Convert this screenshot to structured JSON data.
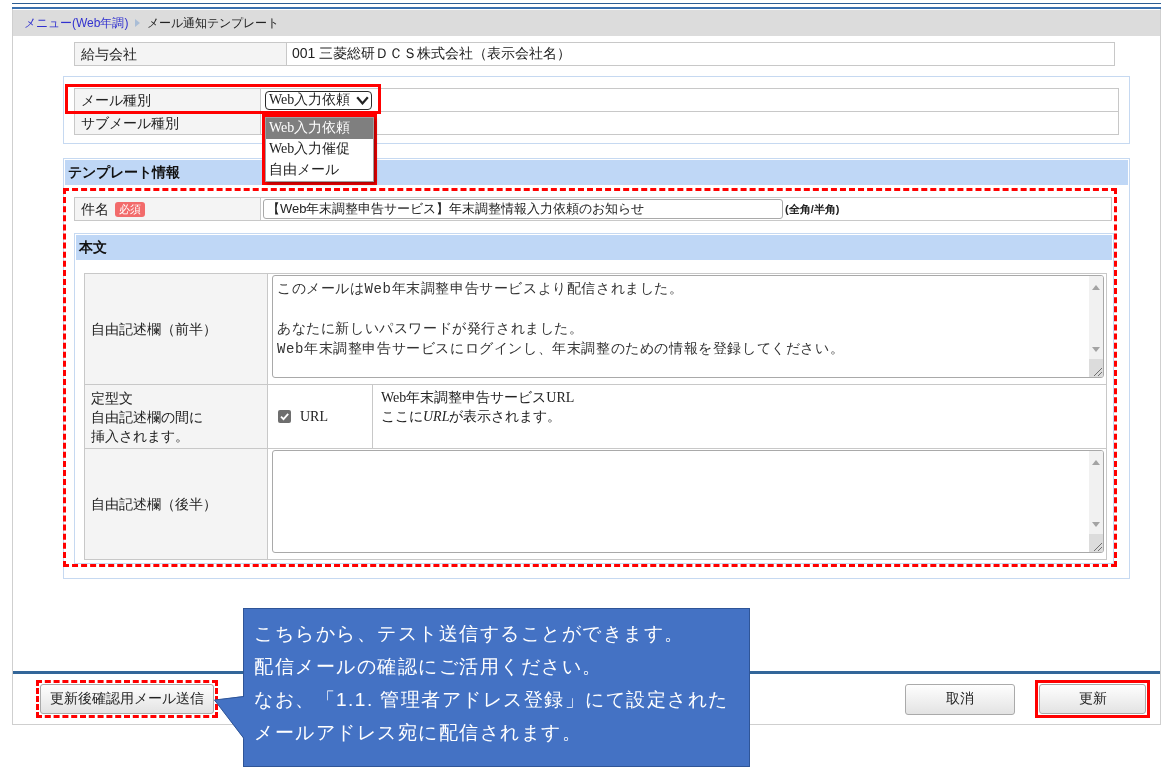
{
  "breadcrumb": [
    {
      "label": "メニュー(Web年調)",
      "kind": "link"
    },
    {
      "label": "メール通知テンプレート",
      "kind": "current"
    }
  ],
  "company": {
    "label": "給与会社",
    "value": "001 三菱総研ＤＣＳ株式会社（表示会社名）"
  },
  "mail_settings": {
    "mail_type": {
      "label": "メール種別",
      "value": "Web入力依頼",
      "highlighted": true,
      "dropdown": {
        "expanded": true,
        "highlighted": true,
        "options": [
          {
            "label": "Web入力依頼",
            "selected": true
          },
          {
            "label": "Web入力催促",
            "selected": false
          },
          {
            "label": "自由メール",
            "selected": false
          }
        ]
      }
    },
    "sub_mail_type": {
      "label": "サブメール種別"
    }
  },
  "template_info": {
    "title": "テンプレート情報",
    "highlighted": true,
    "subject": {
      "label": "件名",
      "badge": "必須",
      "value": "【Web年末調整申告サービス】年末調整情報入力依頼のお知らせ",
      "hint": "(全角/半角)"
    },
    "body": {
      "title": "本文",
      "rows": [
        {
          "kind": "textarea",
          "label": "自由記述欄（前半）",
          "paragraphs": [
            {
              "lines": [
                "このメールはWeb年末調整申告サービスより配信されました。"
              ]
            },
            {
              "lines": [
                "あなたに新しいパスワードが発行されました。",
                "Web年末調整申告サービスにログインし、年末調整のための情報を登録してください。"
              ]
            }
          ]
        },
        {
          "kind": "fixed",
          "label": "定型文",
          "note_lines": [
            "自由記述欄の間に",
            "挿入されます。"
          ],
          "checkbox": {
            "label": "URL",
            "checked": true
          },
          "lines": [
            {
              "runs": [
                {
                  "text": "Web年末調整申告サービスURL",
                  "italic": false
                }
              ]
            },
            {
              "runs": [
                {
                  "text": "ここに",
                  "italic": false
                },
                {
                  "text": "URL",
                  "italic": true
                },
                {
                  "text": "が表示されます。",
                  "italic": false
                }
              ]
            }
          ]
        },
        {
          "kind": "textarea",
          "label": "自由記述欄（後半）"
        }
      ]
    }
  },
  "footer": {
    "test_send": {
      "label": "更新後確認用メール送信",
      "highlighted": true
    },
    "buttons": [
      {
        "label": "取消",
        "highlighted": false
      },
      {
        "label": "更新",
        "highlighted": true
      }
    ]
  },
  "callout": {
    "lines": [
      "こちらから、テスト送信することができます。",
      "配信メールの確認にご活用ください。",
      "なお、「1.1. 管理者アドレス登録」にて設定された",
      "メールアドレス宛に配信されます。"
    ]
  }
}
